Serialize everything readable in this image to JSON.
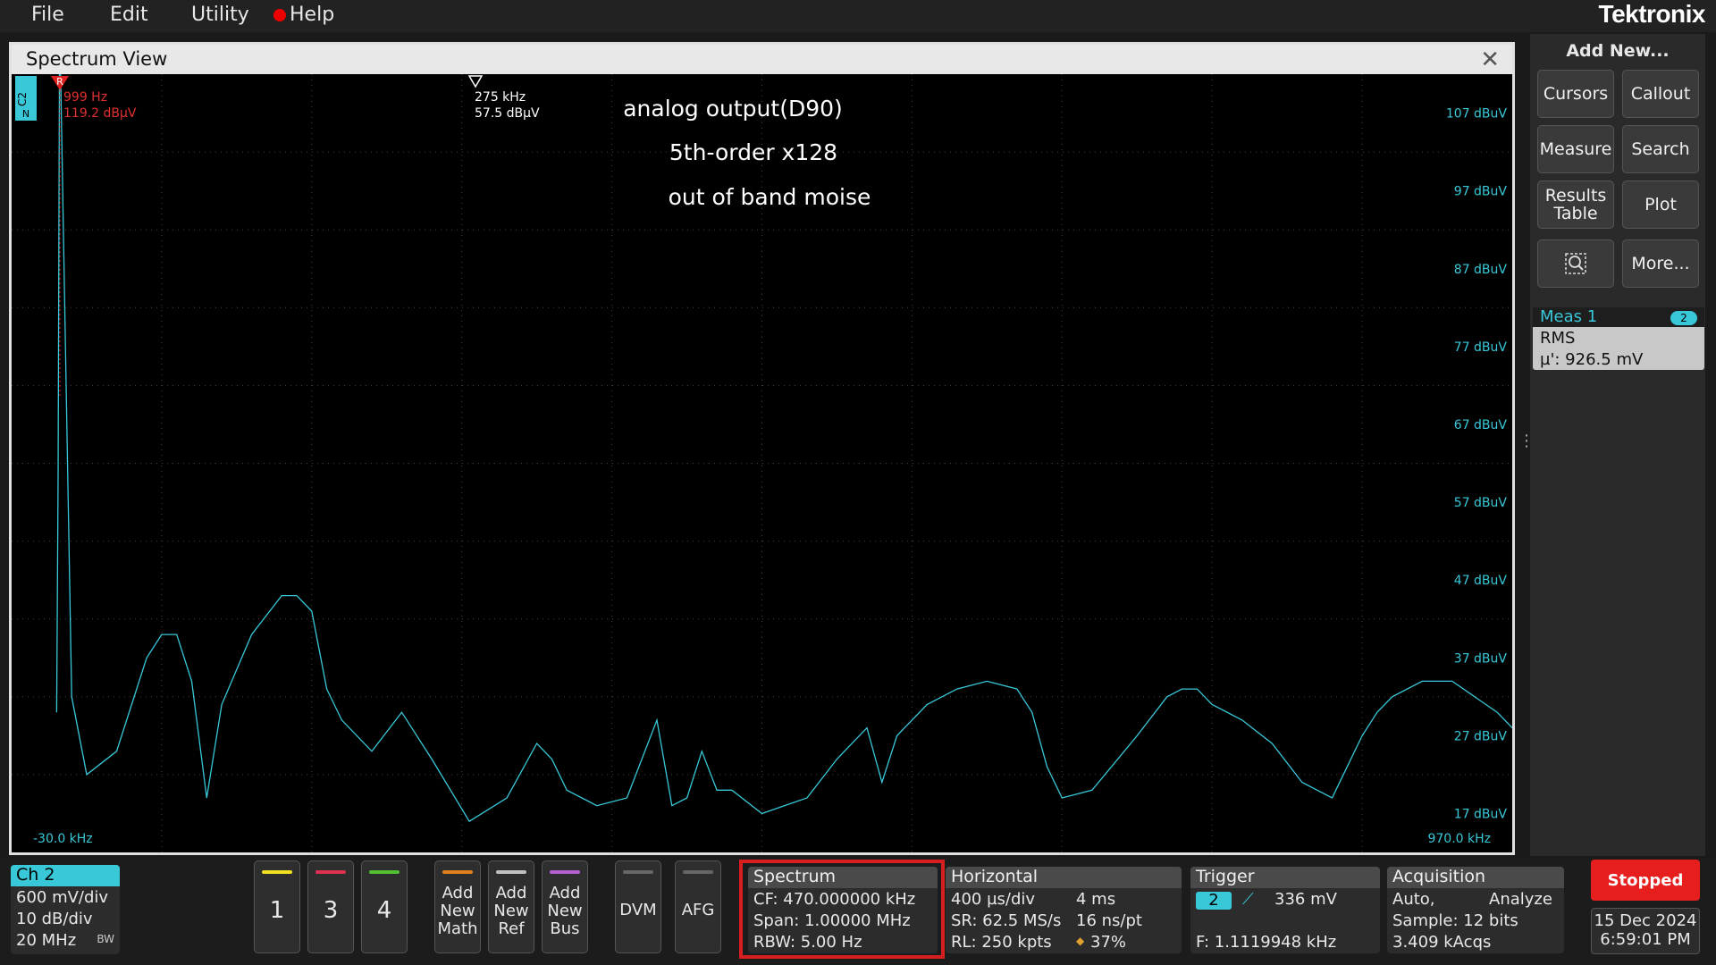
{
  "menu": {
    "file": "File",
    "edit": "Edit",
    "utility": "Utility",
    "help": "Help"
  },
  "brand": "Tektronix",
  "spectrum_view": {
    "title": "Spectrum View",
    "close": "✕",
    "channel_tag": "C2",
    "channel_tag_sub": "N",
    "ref_marker_label": "R",
    "ref_marker": {
      "freq": "999 Hz",
      "level": "119.2 dBµV"
    },
    "cursor_marker": {
      "freq": "275 kHz",
      "level": "57.5 dBµV"
    },
    "annotation_lines": [
      "analog output(D90)",
      "5th-order x128",
      "out of band moise"
    ],
    "x_start_label": "-30.0 kHz",
    "x_end_label": "970.0 kHz",
    "y_labels": [
      "107 dBuV",
      "97 dBuV",
      "87 dBuV",
      "77 dBuV",
      "67 dBuV",
      "57 dBuV",
      "47 dBuV",
      "37 dBuV",
      "27 dBuV",
      "17 dBuV"
    ],
    "trace_color": "#38c8d8"
  },
  "chart_data": {
    "type": "line",
    "xlim": [
      -30,
      970
    ],
    "ylim": [
      12,
      112
    ],
    "grid": true,
    "series": [
      {
        "x": [
          0,
          1,
          2,
          10,
          20,
          40,
          50,
          60,
          70,
          80,
          90,
          100,
          110,
          130,
          150,
          160,
          170,
          175,
          180,
          190,
          210,
          230,
          250,
          275,
          300,
          320,
          330,
          340,
          350,
          360,
          380,
          400,
          410,
          420,
          430,
          440,
          450,
          470,
          500,
          520,
          530,
          540,
          550,
          560,
          580,
          600,
          620,
          640,
          650,
          660,
          670,
          690,
          720,
          740,
          750,
          760,
          770,
          790,
          810,
          830,
          850,
          860,
          870,
          880,
          890,
          910,
          930,
          945,
          960,
          970
        ],
        "y": [
          30,
          60,
          119.2,
          32,
          22,
          25,
          31,
          37,
          40,
          40,
          34,
          19,
          31,
          40,
          45,
          45,
          43,
          38,
          33,
          29,
          25,
          30,
          24,
          16,
          19,
          26,
          24,
          20,
          19,
          18,
          19,
          29,
          18,
          19,
          25,
          20,
          20,
          17,
          19,
          24,
          26,
          28,
          21,
          27,
          31,
          33,
          34,
          33,
          30,
          23,
          19,
          20,
          27,
          32,
          33,
          33,
          31,
          29,
          26,
          21,
          19,
          23,
          27,
          30,
          32,
          34,
          34,
          32,
          30,
          28
        ]
      }
    ]
  },
  "sidebar": {
    "add_new_title": "Add New...",
    "buttons": {
      "cursors": "Cursors",
      "callout": "Callout",
      "measure": "Measure",
      "search": "Search",
      "results_line1": "Results",
      "results_line2": "Table",
      "plot": "Plot",
      "more": "More..."
    },
    "zoom_icon": "zoom-icon",
    "meas1": {
      "title": "Meas 1",
      "badge": "2",
      "name": "RMS",
      "value": "µ': 926.5 mV"
    }
  },
  "bottom": {
    "ch2": {
      "label": "Ch 2",
      "scale": "600 mV/div",
      "spectrum_scale": "10 dB/div",
      "bandwidth": "20 MHz",
      "bw_icon": "BW"
    },
    "channels": [
      {
        "label": "1",
        "color": "#f0e020"
      },
      {
        "label": "3",
        "color": "#e03050"
      },
      {
        "label": "4",
        "color": "#50c030"
      }
    ],
    "add_math": {
      "l1": "Add",
      "l2": "New",
      "l3": "Math",
      "color": "#e08020"
    },
    "add_ref": {
      "l1": "Add",
      "l2": "New",
      "l3": "Ref",
      "color": "#c0c0c0"
    },
    "add_bus": {
      "l1": "Add",
      "l2": "New",
      "l3": "Bus",
      "color": "#b060d0"
    },
    "dvm": "DVM",
    "afg": "AFG",
    "spectrum": {
      "title": "Spectrum",
      "cf": "CF: 470.000000 kHz",
      "span": "Span: 1.00000 MHz",
      "rbw": "RBW: 5.00 Hz"
    },
    "horizontal": {
      "title": "Horizontal",
      "scale": "400 µs/div",
      "length": "4 ms",
      "sr": "SR: 62.5 MS/s",
      "res": "16 ns/pt",
      "rl": "RL: 250 kpts",
      "pct": "37%"
    },
    "trigger": {
      "title": "Trigger",
      "source": "2",
      "level": "336 mV",
      "freq": "F: 1.1119948 kHz"
    },
    "acquisition": {
      "title": "Acquisition",
      "mode": "Auto,",
      "analyze": "Analyze",
      "sample": "Sample: 12 bits",
      "acqs": "3.409 kAcqs"
    },
    "status": "Stopped",
    "date": "15 Dec 2024",
    "time": "6:59:01 PM"
  }
}
